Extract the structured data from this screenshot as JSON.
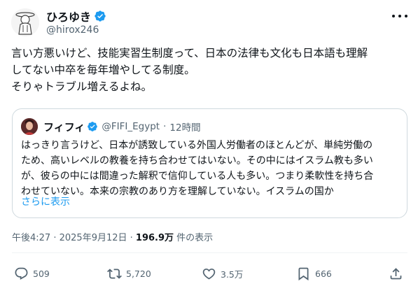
{
  "author": {
    "display_name": "ひろゆき",
    "handle": "@hirox246"
  },
  "tweet": {
    "lines": [
      "言い方悪いけど、技能実習生制度って、日本の法律も文化も日本語も理解",
      "してない中卒を毎年増やしてる制度。",
      "そりゃトラブル増えるよね。"
    ]
  },
  "quote": {
    "display_name": "フィフィ",
    "handle": "@FIFI_Egypt",
    "separator": "·",
    "time": "12時間",
    "lines": [
      "はっきり言うけど、日本が誘致している外国人労働者のほとんどが、単純労働の",
      "ため、高いレベルの教養を持ち合わせてはいない。その中にはイスラム教も多い",
      "が、彼らの中には間違った解釈で信仰している人も多い。つまり柔軟性を持ち合",
      "わせていない。本来の宗教のあり方を理解していない。イスラムの国か"
    ],
    "show_more": "さらに表示"
  },
  "meta": {
    "time": "午後4:27",
    "sep1": " · ",
    "date": "2025年9月12日",
    "sep2": " · ",
    "views": "196.9万",
    "views_label": " 件の表示"
  },
  "actions": {
    "replies": "509",
    "reposts": "5,720",
    "likes": "3.5万",
    "bookmarks": "666"
  },
  "colors": {
    "accent": "#1d9bf0",
    "secondary_text": "#536471",
    "primary_text": "#0f1419",
    "border": "#cfd9de"
  },
  "icons": {
    "verified": "verified-badge-icon",
    "more": "more-dots-icon",
    "reply": "reply-bubble-icon",
    "repost": "repost-arrows-icon",
    "like": "heart-icon",
    "bookmark": "bookmark-icon",
    "share": "share-upload-icon"
  }
}
